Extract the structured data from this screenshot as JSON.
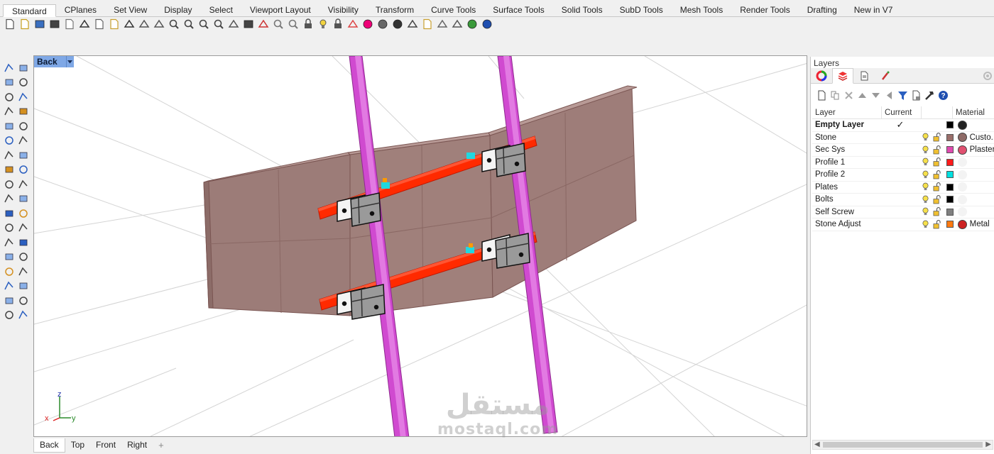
{
  "tabs": [
    "Standard",
    "CPlanes",
    "Set View",
    "Display",
    "Select",
    "Viewport Layout",
    "Visibility",
    "Transform",
    "Curve Tools",
    "Surface Tools",
    "Solid Tools",
    "SubD Tools",
    "Mesh Tools",
    "Render Tools",
    "Drafting",
    "New in V7"
  ],
  "active_tab": "Standard",
  "toolbar_icons": [
    "new-file-icon",
    "open-file-icon",
    "save-icon",
    "print-icon",
    "import-icon",
    "cut-icon",
    "copy-icon",
    "paste-icon",
    "undo-icon",
    "pan-icon",
    "rotate-view-icon",
    "zoom-icon",
    "zoom-window-icon",
    "zoom-extents-icon",
    "zoom-selected-icon",
    "rotate-icon",
    "four-viewports-icon",
    "car-icon",
    "hide-icon",
    "show-icon",
    "lock-icon",
    "light-icon",
    "unlock-icon",
    "layer-icon",
    "color-wheel-icon",
    "shaded-sphere-icon",
    "rendered-sphere-icon",
    "render-icon",
    "properties-icon",
    "options-icon",
    "move-icon",
    "web-icon",
    "help-icon"
  ],
  "viewport": {
    "name": "Back",
    "axis_labels": {
      "z": "z",
      "x": "x",
      "y": "y"
    }
  },
  "viewport_tabs": [
    "Back",
    "Top",
    "Front",
    "Right"
  ],
  "viewport_tab_add": "+",
  "layers_panel": {
    "title": "Layers",
    "columns": {
      "name": "Layer",
      "current": "Current",
      "material": "Material"
    },
    "rows": [
      {
        "name": "Empty Layer",
        "current": "✓",
        "color": "#000000",
        "material_color": "#222222",
        "material": "",
        "bold": true
      },
      {
        "name": "Stone",
        "current": "",
        "color": "#9a6e6a",
        "material_color": "#8e6a66",
        "material": "Custo..."
      },
      {
        "name": "Sec Sys",
        "current": "",
        "color": "#e04ab0",
        "material_color": "#e05070",
        "material": "Plaster"
      },
      {
        "name": "Profile 1",
        "current": "",
        "color": "#ff1a1a",
        "material_color": "",
        "material": ""
      },
      {
        "name": "Profile 2",
        "current": "",
        "color": "#00e0e0",
        "material_color": "",
        "material": ""
      },
      {
        "name": "Plates",
        "current": "",
        "color": "#000000",
        "material_color": "",
        "material": ""
      },
      {
        "name": "Bolts",
        "current": "",
        "color": "#000000",
        "material_color": "",
        "material": ""
      },
      {
        "name": "Self Screw",
        "current": "",
        "color": "#808080",
        "material_color": "",
        "material": ""
      },
      {
        "name": "Stone Adjust",
        "current": "",
        "color": "#ff7a10",
        "material_color": "#cc2222",
        "material": "Metal"
      }
    ]
  },
  "watermark": {
    "arabic": "مستقل",
    "latin": "mostaql.com"
  },
  "colors": {
    "viewport_title": "#7fa8e6",
    "stone": "#9c7c78",
    "column": "#d04ad0",
    "rail": "#ff2200",
    "clip": "#20d8e0"
  }
}
